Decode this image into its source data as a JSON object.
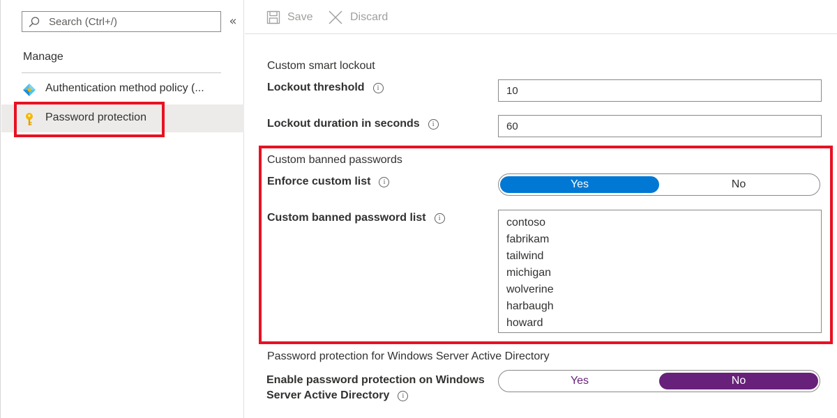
{
  "sidebar": {
    "search": {
      "placeholder": "Search (Ctrl+/)",
      "value": ""
    },
    "collapse_glyph": "«",
    "manage_heading": "Manage",
    "items": [
      {
        "label": "Authentication method policy (...",
        "icon": "diamond-icon",
        "selected": false
      },
      {
        "label": "Password protection",
        "icon": "key-icon",
        "selected": true
      }
    ]
  },
  "toolbar": {
    "save_label": "Save",
    "discard_label": "Discard"
  },
  "lockout": {
    "section_title": "Custom smart lockout",
    "threshold_label": "Lockout threshold",
    "threshold_value": "10",
    "duration_label": "Lockout duration in seconds",
    "duration_value": "60"
  },
  "banned": {
    "section_title": "Custom banned passwords",
    "enforce_label": "Enforce custom list",
    "enforce_options": [
      "Yes",
      "No"
    ],
    "enforce_selected": "Yes",
    "list_label": "Custom banned password list",
    "list_values": [
      "contoso",
      "fabrikam",
      "tailwind",
      "michigan",
      "wolverine",
      "harbaugh",
      "howard"
    ]
  },
  "windows": {
    "section_title": "Password protection for Windows Server Active Directory",
    "enable_label_line1": "Enable password protection on Windows",
    "enable_label_line2": "Server Active Directory",
    "enable_options": [
      "Yes",
      "No"
    ],
    "enable_selected": "No"
  },
  "info_glyph": "i",
  "colors": {
    "accent_blue": "#0078d4",
    "accent_purple": "#68217a",
    "highlight_red": "#e81123",
    "selected_nav_bg": "#edebe9"
  }
}
